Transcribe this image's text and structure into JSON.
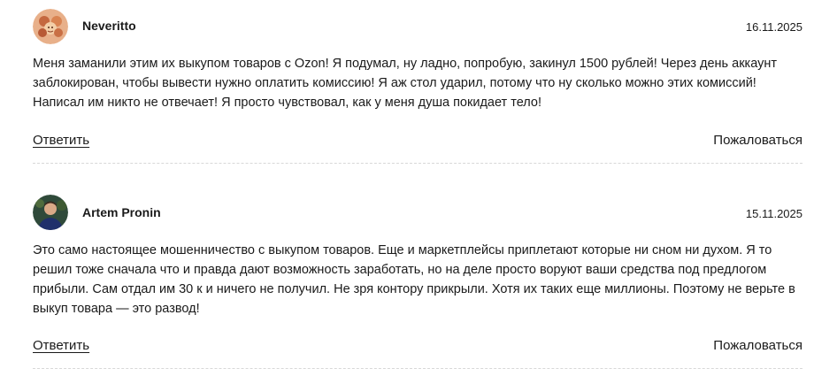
{
  "comments": [
    {
      "author": "Neveritto",
      "date": "16.11.2025",
      "text": "Меня заманили этим их выкупом товаров с Ozon! Я подумал, ну ладно, попробую, закинул 1500 рублей! Через день аккаунт заблокирован, чтобы вывести нужно оплатить комиссию! Я аж стол ударил, потому что ну сколько можно этих комиссий! Написал им никто не отвечает! Я просто чувствовал, как у меня душа покидает тело!",
      "reply_label": "Ответить",
      "report_label": "Пожаловаться"
    },
    {
      "author": "Artem Pronin",
      "date": "15.11.2025",
      "text": "Это само настоящее мошенничество с выкупом товаров. Еще и маркетплейсы приплетают которые ни сном ни духом. Я то решил тоже сначала что и правда дают возможность заработать, но на деле просто воруют ваши средства под предлогом прибыли. Сам отдал им 30 к и ничего не получил. Не зря контору прикрыли. Хотя их таких еще миллионы. Поэтому не верьте в выкуп товара — это развод!",
      "reply_label": "Ответить",
      "report_label": "Пожаловаться"
    }
  ]
}
